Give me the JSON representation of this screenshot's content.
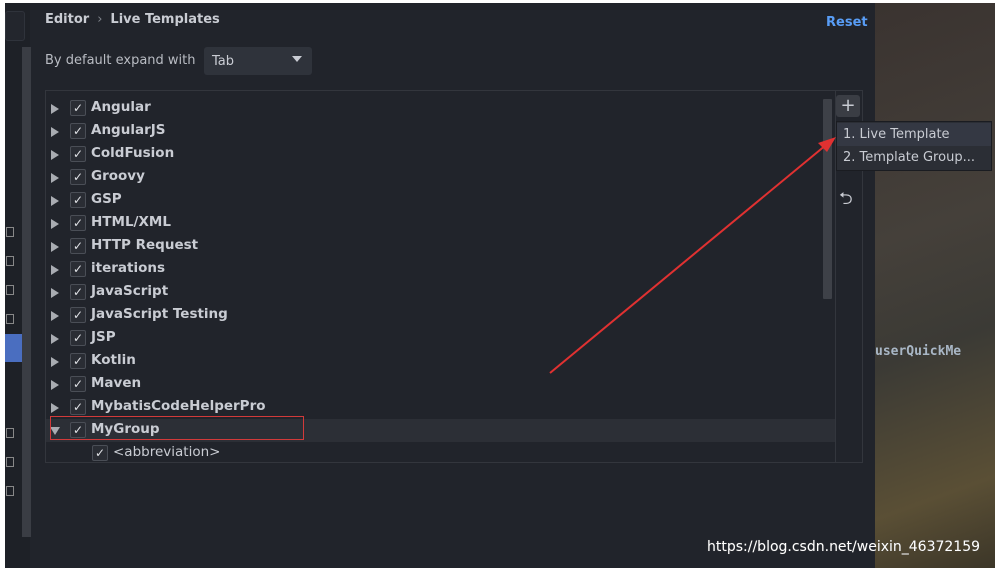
{
  "breadcrumb": {
    "parent": "Editor",
    "separator": "›",
    "current": "Live Templates"
  },
  "reset_label": "Reset",
  "expand": {
    "label": "By default expand with",
    "value": "Tab"
  },
  "groups": [
    {
      "label": "Angular",
      "checked": true
    },
    {
      "label": "AngularJS",
      "checked": true
    },
    {
      "label": "ColdFusion",
      "checked": true
    },
    {
      "label": "Groovy",
      "checked": true
    },
    {
      "label": "GSP",
      "checked": true
    },
    {
      "label": "HTML/XML",
      "checked": true
    },
    {
      "label": "HTTP Request",
      "checked": true
    },
    {
      "label": "iterations",
      "checked": true
    },
    {
      "label": "JavaScript",
      "checked": true
    },
    {
      "label": "JavaScript Testing",
      "checked": true
    },
    {
      "label": "JSP",
      "checked": true
    },
    {
      "label": "Kotlin",
      "checked": true
    },
    {
      "label": "Maven",
      "checked": true
    },
    {
      "label": "MybatisCodeHelperPro",
      "checked": true
    },
    {
      "label": "MyGroup",
      "checked": true,
      "expanded": true,
      "selected": true
    }
  ],
  "child": {
    "label": "<abbreviation>",
    "checked": true
  },
  "checkmark": "✓",
  "toolbar": {
    "add": "+",
    "undo": "⮌"
  },
  "add_menu": [
    "1. Live Template",
    "2. Template Group..."
  ],
  "background_code": "userQuickMe",
  "watermark": "https://blog.csdn.net/weixin_46372159",
  "colors": {
    "accent": "#589df6",
    "annotation": "#e03131",
    "background": "#21242b"
  }
}
